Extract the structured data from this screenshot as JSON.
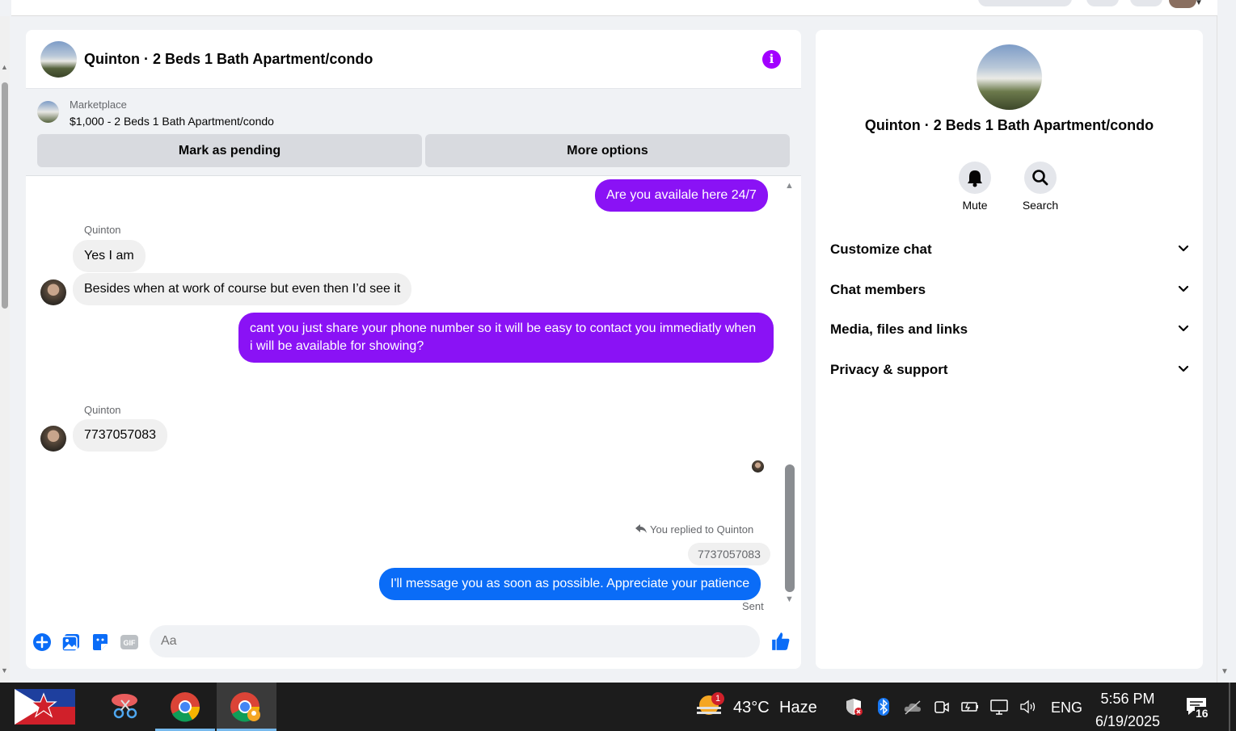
{
  "chat": {
    "title": "Quinton · 2 Beds 1 Bath Apartment/condo",
    "info_icon": "info-icon",
    "marketplace": {
      "label": "Marketplace",
      "listing": "$1,000 - 2 Beds 1 Bath Apartment/condo",
      "mark_pending": "Mark as pending",
      "more_options": "More options"
    },
    "messages": {
      "m1": "Are you availale here 24/7",
      "sender1": "Quinton",
      "m2": "Yes I am",
      "m3": "Besides when at work of course but even then I’d see it",
      "m4": "cant you just share your phone number so it will be easy to contact you immediatly when i will be available for showing?",
      "sender2": "Quinton",
      "m5": "7737057083",
      "replied": "You replied to Quinton",
      "quoted": "7737057083",
      "m6": "I'll message you as soon as possible. Appreciate your patience",
      "status": "Sent"
    },
    "composer": {
      "placeholder": "Aa"
    },
    "colors": {
      "outgoing": "#8a12f5",
      "outgoing_latest": "#0a6cf7",
      "accent": "#a200ff"
    }
  },
  "info_panel": {
    "name": "Quinton · 2 Beds 1 Bath Apartment/condo",
    "mute": "Mute",
    "search": "Search",
    "sections": [
      "Customize chat",
      "Chat members",
      "Media, files and links",
      "Privacy & support"
    ]
  },
  "taskbar": {
    "weather_temp": "43°C",
    "weather_desc": "Haze",
    "weather_badge": "1",
    "language": "ENG",
    "time": "5:56 PM",
    "date": "6/19/2025",
    "notifications": "16"
  }
}
